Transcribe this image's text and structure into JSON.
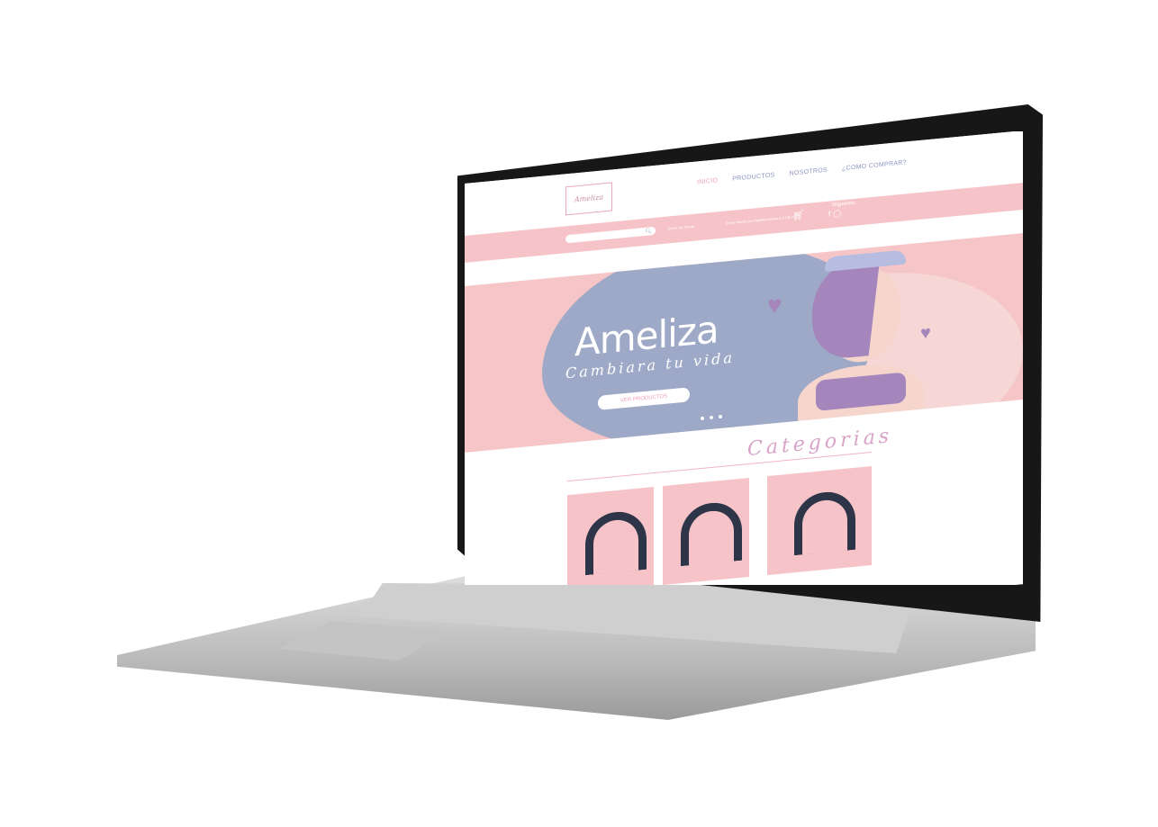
{
  "nav": {
    "menu": [
      "INICIO",
      "PRODUCTOS",
      "NOSOTROS",
      "¿COMO COMPRAR?"
    ],
    "logo_text": "Ameliza"
  },
  "topbar": {
    "search_placeholder": "",
    "info_left": "Envío de Tienda",
    "info_right": "Envío directo por nuestra cuenta a 3 145 info",
    "follow": "Síguenos"
  },
  "hero": {
    "title": "Ameliza",
    "tagline": "Cambiara tu vida",
    "cta": "VER PRODUCTOS"
  },
  "categories": {
    "title": "Categorias",
    "cards": [
      {},
      {},
      {}
    ]
  },
  "colors": {
    "pink": "#f6c4c8",
    "lavender": "#9ea9c7",
    "purple": "#a486bd",
    "accent": "#ee9fb0"
  }
}
